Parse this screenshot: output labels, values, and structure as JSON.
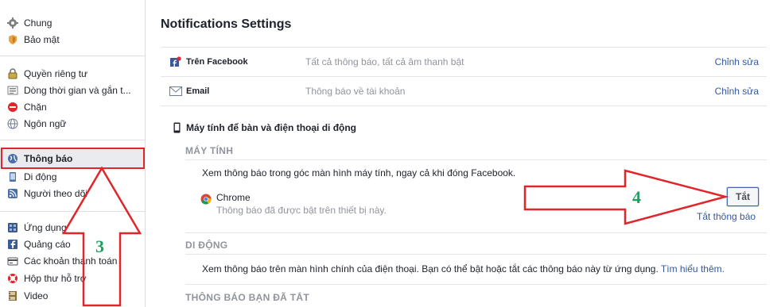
{
  "sidebar": {
    "group1": [
      {
        "label": "Chung",
        "icon": "gear-icon"
      },
      {
        "label": "Bảo mật",
        "icon": "shield-icon"
      }
    ],
    "group2": [
      {
        "label": "Quyền riêng tư",
        "icon": "lock-icon"
      },
      {
        "label": "Dòng thời gian và gắn t...",
        "icon": "timeline-icon"
      },
      {
        "label": "Chặn",
        "icon": "block-icon"
      },
      {
        "label": "Ngôn ngữ",
        "icon": "globe-icon"
      }
    ],
    "group3": [
      {
        "label": "Thông báo",
        "icon": "globe-notification-icon",
        "active": true
      },
      {
        "label": "Di động",
        "icon": "mobile-icon"
      },
      {
        "label": "Người theo dõi",
        "icon": "rss-icon"
      }
    ],
    "group4": [
      {
        "label": "Ứng dụng",
        "icon": "apps-icon"
      },
      {
        "label": "Quảng cáo",
        "icon": "ads-icon"
      },
      {
        "label": "Các khoản thanh toán",
        "icon": "payment-icon"
      },
      {
        "label": "Hộp thư hỗ trợ",
        "icon": "lifebuoy-icon"
      },
      {
        "label": "Video",
        "icon": "film-icon"
      }
    ]
  },
  "main": {
    "title": "Notifications Settings",
    "rows": [
      {
        "label": "Trên Facebook",
        "desc": "Tất cả thông báo, tất cả âm thanh bật",
        "edit": "Chỉnh sửa",
        "icon": "facebook-notification-icon"
      },
      {
        "label": "Email",
        "desc": "Thông báo về tài khoản",
        "edit": "Chỉnh sửa",
        "icon": "email-icon"
      }
    ],
    "section_title": "Máy tính để bàn và điện thoại di động",
    "desktop": {
      "caption": "MÁY TÍNH",
      "desc": "Xem thông báo trong góc màn hình máy tính, ngay cả khi đóng Facebook.",
      "browser_name": "Chrome",
      "browser_status": "Thông báo đã được bật trên thiết bị này.",
      "off_button": "Tắt",
      "off_link": "Tắt thông báo"
    },
    "mobile": {
      "caption": "DI ĐỘNG",
      "desc": "Xem thông báo trên màn hình chính của điện thoại. Bạn có thể bật hoặc tắt các thông báo này từ ứng dụng.",
      "link": "Tìm hiểu thêm."
    },
    "muted": {
      "caption": "THÔNG BÁO BẠN ĐÃ TẮT"
    }
  },
  "annotations": {
    "step3": "3",
    "step4": "4",
    "highlight_color": "#e0262b",
    "number_color": "#1aa260"
  }
}
